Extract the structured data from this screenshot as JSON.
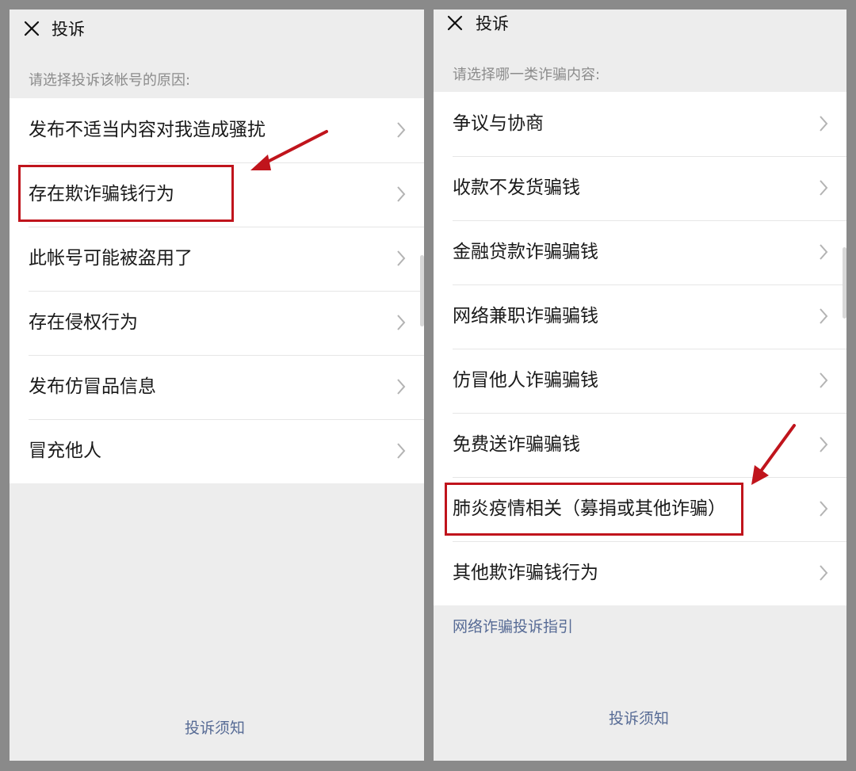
{
  "left": {
    "title": "投诉",
    "prompt": "请选择投诉该帐号的原因:",
    "items": [
      {
        "label": "发布不适当内容对我造成骚扰"
      },
      {
        "label": "存在欺诈骗钱行为"
      },
      {
        "label": "此帐号可能被盗用了"
      },
      {
        "label": "存在侵权行为"
      },
      {
        "label": "发布仿冒品信息"
      },
      {
        "label": "冒充他人"
      }
    ],
    "footer_link": "投诉须知"
  },
  "right": {
    "title": "投诉",
    "prompt": "请选择哪一类诈骗内容:",
    "items": [
      {
        "label": "争议与协商"
      },
      {
        "label": "收款不发货骗钱"
      },
      {
        "label": "金融贷款诈骗骗钱"
      },
      {
        "label": "网络兼职诈骗骗钱"
      },
      {
        "label": "仿冒他人诈骗骗钱"
      },
      {
        "label": "免费送诈骗骗钱"
      },
      {
        "label": "肺炎疫情相关（募捐或其他诈骗）"
      },
      {
        "label": "其他欺诈骗钱行为"
      }
    ],
    "guide_link": "网络诈骗投诉指引",
    "footer_link": "投诉须知"
  },
  "colors": {
    "highlight": "#c0141c",
    "link": "#576b95",
    "panel_bg": "#ededed",
    "frame_bg": "#8a8a8a"
  },
  "icons": {
    "close": "close-icon",
    "chevron": "chevron-right-icon",
    "annotation_arrow": "arrow-icon"
  }
}
